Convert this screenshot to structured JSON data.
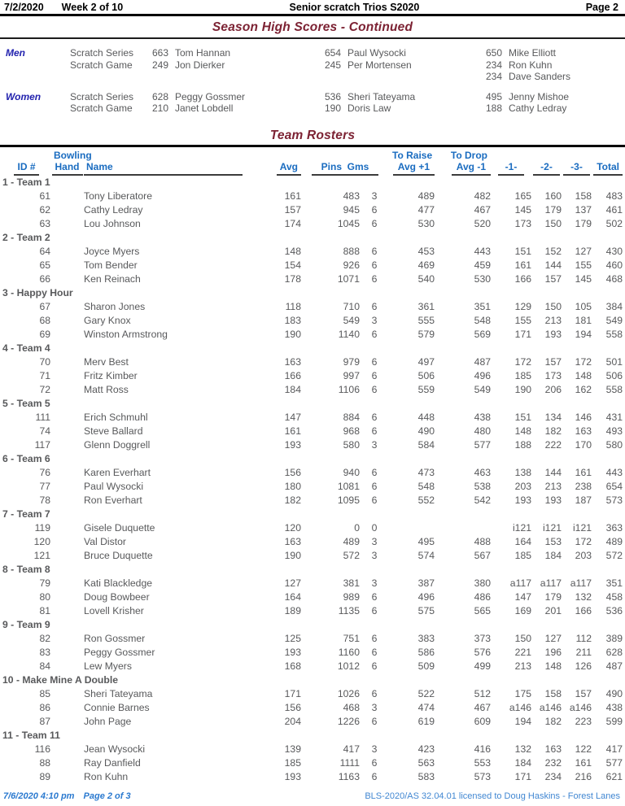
{
  "page_header": {
    "date": "7/2/2020",
    "week": "Week 2 of 10",
    "league": "Senior scratch Trios S2020",
    "page": "Page 2"
  },
  "high_scores": {
    "title": "Season High Scores - Continued",
    "groups": [
      {
        "label": "Men",
        "rows": [
          {
            "category": "Scratch Series",
            "entries": [
              {
                "score": "663",
                "name": "Tom Hannan"
              },
              {
                "score": "654",
                "name": "Paul Wysocki"
              },
              {
                "score": "650",
                "name": "Mike Elliott"
              }
            ]
          },
          {
            "category": "Scratch Game",
            "entries": [
              {
                "score": "249",
                "name": "Jon Dierker"
              },
              {
                "score": "245",
                "name": "Per Mortensen"
              },
              {
                "score": "234",
                "name": "Ron Kuhn"
              }
            ]
          },
          {
            "category": "",
            "entries": [
              {
                "score": "",
                "name": ""
              },
              {
                "score": "",
                "name": ""
              },
              {
                "score": "234",
                "name": "Dave Sanders"
              }
            ]
          }
        ]
      },
      {
        "label": "Women",
        "rows": [
          {
            "category": "Scratch Series",
            "entries": [
              {
                "score": "628",
                "name": "Peggy Gossmer"
              },
              {
                "score": "536",
                "name": "Sheri Tateyama"
              },
              {
                "score": "495",
                "name": "Jenny Mishoe"
              }
            ]
          },
          {
            "category": "Scratch Game",
            "entries": [
              {
                "score": "210",
                "name": "Janet Lobdell"
              },
              {
                "score": "190",
                "name": "Doris Law"
              },
              {
                "score": "188",
                "name": "Cathy Ledray"
              }
            ]
          }
        ]
      }
    ]
  },
  "roster": {
    "title": "Team Rosters",
    "columns": {
      "id": "ID #",
      "hand_top": "Bowling",
      "hand": "Hand",
      "name": "Name",
      "avg": "Avg",
      "pins": "Pins",
      "gms": "Gms",
      "raise_top": "To Raise",
      "raise": "Avg +1",
      "drop_top": "To Drop",
      "drop": "Avg -1",
      "g1": "-1-",
      "g2": "-2-",
      "g3": "-3-",
      "total": "Total"
    },
    "teams": [
      {
        "name": "1 - Team 1",
        "players": [
          {
            "id": "61",
            "name": "Tony Liberatore",
            "avg": "161",
            "pins": "483",
            "gms": "3",
            "raise": "489",
            "drop": "482",
            "g1": "165",
            "g2": "160",
            "g3": "158",
            "total": "483"
          },
          {
            "id": "62",
            "name": "Cathy Ledray",
            "avg": "157",
            "pins": "945",
            "gms": "6",
            "raise": "477",
            "drop": "467",
            "g1": "145",
            "g2": "179",
            "g3": "137",
            "total": "461"
          },
          {
            "id": "63",
            "name": "Lou Johnson",
            "avg": "174",
            "pins": "1045",
            "gms": "6",
            "raise": "530",
            "drop": "520",
            "g1": "173",
            "g2": "150",
            "g3": "179",
            "total": "502"
          }
        ]
      },
      {
        "name": "2 - Team 2",
        "players": [
          {
            "id": "64",
            "name": "Joyce Myers",
            "avg": "148",
            "pins": "888",
            "gms": "6",
            "raise": "453",
            "drop": "443",
            "g1": "151",
            "g2": "152",
            "g3": "127",
            "total": "430"
          },
          {
            "id": "65",
            "name": "Tom Bender",
            "avg": "154",
            "pins": "926",
            "gms": "6",
            "raise": "469",
            "drop": "459",
            "g1": "161",
            "g2": "144",
            "g3": "155",
            "total": "460"
          },
          {
            "id": "66",
            "name": "Ken Reinach",
            "avg": "178",
            "pins": "1071",
            "gms": "6",
            "raise": "540",
            "drop": "530",
            "g1": "166",
            "g2": "157",
            "g3": "145",
            "total": "468"
          }
        ]
      },
      {
        "name": "3 - Happy Hour",
        "players": [
          {
            "id": "67",
            "name": "Sharon Jones",
            "avg": "118",
            "pins": "710",
            "gms": "6",
            "raise": "361",
            "drop": "351",
            "g1": "129",
            "g2": "150",
            "g3": "105",
            "total": "384"
          },
          {
            "id": "68",
            "name": "Gary Knox",
            "avg": "183",
            "pins": "549",
            "gms": "3",
            "raise": "555",
            "drop": "548",
            "g1": "155",
            "g2": "213",
            "g3": "181",
            "total": "549"
          },
          {
            "id": "69",
            "name": "Winston Armstrong",
            "avg": "190",
            "pins": "1140",
            "gms": "6",
            "raise": "579",
            "drop": "569",
            "g1": "171",
            "g2": "193",
            "g3": "194",
            "total": "558"
          }
        ]
      },
      {
        "name": "4 - Team 4",
        "players": [
          {
            "id": "70",
            "name": "Merv Best",
            "avg": "163",
            "pins": "979",
            "gms": "6",
            "raise": "497",
            "drop": "487",
            "g1": "172",
            "g2": "157",
            "g3": "172",
            "total": "501"
          },
          {
            "id": "71",
            "name": "Fritz Kimber",
            "avg": "166",
            "pins": "997",
            "gms": "6",
            "raise": "506",
            "drop": "496",
            "g1": "185",
            "g2": "173",
            "g3": "148",
            "total": "506"
          },
          {
            "id": "72",
            "name": "Matt Ross",
            "avg": "184",
            "pins": "1106",
            "gms": "6",
            "raise": "559",
            "drop": "549",
            "g1": "190",
            "g2": "206",
            "g3": "162",
            "total": "558"
          }
        ]
      },
      {
        "name": "5 - Team 5",
        "players": [
          {
            "id": "111",
            "name": "Erich Schmuhl",
            "avg": "147",
            "pins": "884",
            "gms": "6",
            "raise": "448",
            "drop": "438",
            "g1": "151",
            "g2": "134",
            "g3": "146",
            "total": "431"
          },
          {
            "id": "74",
            "name": "Steve Ballard",
            "avg": "161",
            "pins": "968",
            "gms": "6",
            "raise": "490",
            "drop": "480",
            "g1": "148",
            "g2": "182",
            "g3": "163",
            "total": "493"
          },
          {
            "id": "117",
            "name": "Glenn Doggrell",
            "avg": "193",
            "pins": "580",
            "gms": "3",
            "raise": "584",
            "drop": "577",
            "g1": "188",
            "g2": "222",
            "g3": "170",
            "total": "580"
          }
        ]
      },
      {
        "name": "6 - Team 6",
        "players": [
          {
            "id": "76",
            "name": "Karen Everhart",
            "avg": "156",
            "pins": "940",
            "gms": "6",
            "raise": "473",
            "drop": "463",
            "g1": "138",
            "g2": "144",
            "g3": "161",
            "total": "443"
          },
          {
            "id": "77",
            "name": "Paul Wysocki",
            "avg": "180",
            "pins": "1081",
            "gms": "6",
            "raise": "548",
            "drop": "538",
            "g1": "203",
            "g2": "213",
            "g3": "238",
            "total": "654"
          },
          {
            "id": "78",
            "name": "Ron Everhart",
            "avg": "182",
            "pins": "1095",
            "gms": "6",
            "raise": "552",
            "drop": "542",
            "g1": "193",
            "g2": "193",
            "g3": "187",
            "total": "573"
          }
        ]
      },
      {
        "name": "7 - Team 7",
        "players": [
          {
            "id": "119",
            "name": "Gisele Duquette",
            "avg": "120",
            "pins": "0",
            "gms": "0",
            "raise": "",
            "drop": "",
            "g1": "i121",
            "g2": "i121",
            "g3": "i121",
            "total": "363"
          },
          {
            "id": "120",
            "name": "Val Distor",
            "avg": "163",
            "pins": "489",
            "gms": "3",
            "raise": "495",
            "drop": "488",
            "g1": "164",
            "g2": "153",
            "g3": "172",
            "total": "489"
          },
          {
            "id": "121",
            "name": "Bruce Duquette",
            "avg": "190",
            "pins": "572",
            "gms": "3",
            "raise": "574",
            "drop": "567",
            "g1": "185",
            "g2": "184",
            "g3": "203",
            "total": "572"
          }
        ]
      },
      {
        "name": "8 - Team 8",
        "players": [
          {
            "id": "79",
            "name": "Kati Blackledge",
            "avg": "127",
            "pins": "381",
            "gms": "3",
            "raise": "387",
            "drop": "380",
            "g1": "a117",
            "g2": "a117",
            "g3": "a117",
            "total": "351"
          },
          {
            "id": "80",
            "name": "Doug Bowbeer",
            "avg": "164",
            "pins": "989",
            "gms": "6",
            "raise": "496",
            "drop": "486",
            "g1": "147",
            "g2": "179",
            "g3": "132",
            "total": "458"
          },
          {
            "id": "81",
            "name": "Lovell Krisher",
            "avg": "189",
            "pins": "1135",
            "gms": "6",
            "raise": "575",
            "drop": "565",
            "g1": "169",
            "g2": "201",
            "g3": "166",
            "total": "536"
          }
        ]
      },
      {
        "name": "9 - Team 9",
        "players": [
          {
            "id": "82",
            "name": "Ron Gossmer",
            "avg": "125",
            "pins": "751",
            "gms": "6",
            "raise": "383",
            "drop": "373",
            "g1": "150",
            "g2": "127",
            "g3": "112",
            "total": "389"
          },
          {
            "id": "83",
            "name": "Peggy Gossmer",
            "avg": "193",
            "pins": "1160",
            "gms": "6",
            "raise": "586",
            "drop": "576",
            "g1": "221",
            "g2": "196",
            "g3": "211",
            "total": "628"
          },
          {
            "id": "84",
            "name": "Lew Myers",
            "avg": "168",
            "pins": "1012",
            "gms": "6",
            "raise": "509",
            "drop": "499",
            "g1": "213",
            "g2": "148",
            "g3": "126",
            "total": "487"
          }
        ]
      },
      {
        "name": "10 - Make Mine A Double",
        "players": [
          {
            "id": "85",
            "name": "Sheri Tateyama",
            "avg": "171",
            "pins": "1026",
            "gms": "6",
            "raise": "522",
            "drop": "512",
            "g1": "175",
            "g2": "158",
            "g3": "157",
            "total": "490"
          },
          {
            "id": "86",
            "name": "Connie Barnes",
            "avg": "156",
            "pins": "468",
            "gms": "3",
            "raise": "474",
            "drop": "467",
            "g1": "a146",
            "g2": "a146",
            "g3": "a146",
            "total": "438"
          },
          {
            "id": "87",
            "name": "John Page",
            "avg": "204",
            "pins": "1226",
            "gms": "6",
            "raise": "619",
            "drop": "609",
            "g1": "194",
            "g2": "182",
            "g3": "223",
            "total": "599"
          }
        ]
      },
      {
        "name": "11 - Team 11",
        "players": [
          {
            "id": "116",
            "name": "Jean Wysocki",
            "avg": "139",
            "pins": "417",
            "gms": "3",
            "raise": "423",
            "drop": "416",
            "g1": "132",
            "g2": "163",
            "g3": "122",
            "total": "417"
          },
          {
            "id": "88",
            "name": "Ray Danfield",
            "avg": "185",
            "pins": "1111",
            "gms": "6",
            "raise": "563",
            "drop": "553",
            "g1": "184",
            "g2": "232",
            "g3": "161",
            "total": "577"
          },
          {
            "id": "89",
            "name": "Ron Kuhn",
            "avg": "193",
            "pins": "1163",
            "gms": "6",
            "raise": "583",
            "drop": "573",
            "g1": "171",
            "g2": "234",
            "g3": "216",
            "total": "621"
          }
        ]
      }
    ]
  },
  "footer": {
    "date": "7/6/2020",
    "time": "4:10 pm",
    "page": "Page 2 of 3",
    "license": "BLS-2020/AS 32.04.01 licensed to Doug Haskins - Forest Lanes"
  },
  "colors": {
    "title_maroon": "#7c2233",
    "header_blue": "#1a6cc0",
    "team_green": "#1f9a3a",
    "data_gray": "#58595b",
    "score_black": "#1f1f21",
    "footer_blue": "#2a79cf"
  }
}
